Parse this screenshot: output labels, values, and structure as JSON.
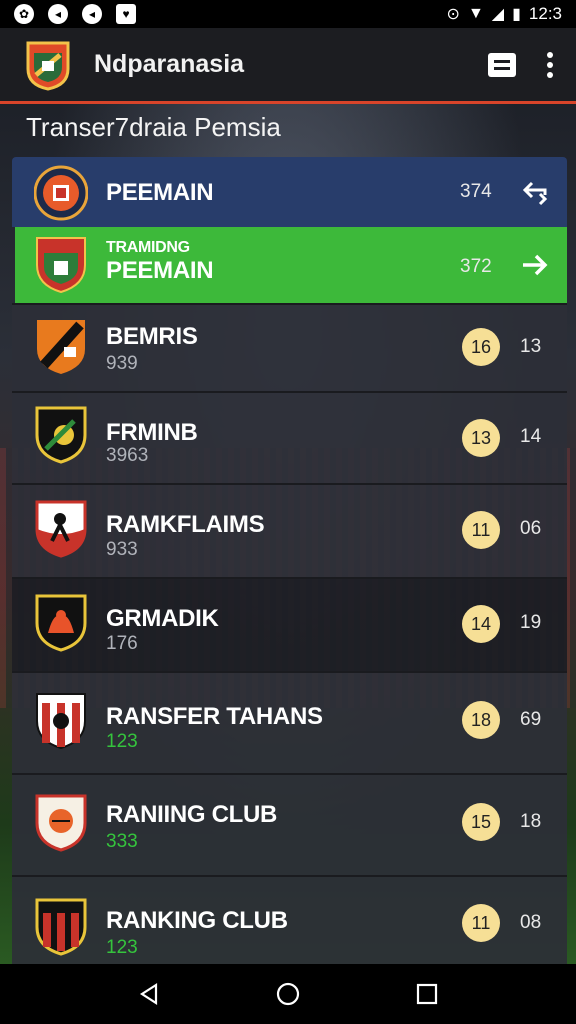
{
  "status_bar": {
    "left_icons": [
      "notification-icon-1",
      "notification-icon-2",
      "notification-icon-3",
      "notification-icon-4"
    ],
    "time": "12:3"
  },
  "app_bar": {
    "title": "Ndparanasia",
    "actions": [
      "list-icon",
      "more-vert-icon"
    ]
  },
  "section_title": "Transer7draia Pemsia",
  "rows": [
    {
      "name": "PEEMAIN",
      "score": "374",
      "icon": "swap-icon"
    },
    {
      "small_label": "TRAMIDNG",
      "name": "PEEMAIN",
      "score": "372",
      "icon": "arrow-right-icon"
    },
    {
      "name": "BEMRIS",
      "sub": "939",
      "badge": "16",
      "value": "13"
    },
    {
      "name": "FRMINB",
      "sub": "3963",
      "badge": "13",
      "value": "14"
    },
    {
      "name": "RAMKFLAIMS",
      "sub": "933",
      "badge": "11",
      "value": "06"
    },
    {
      "name": "GRMADIK",
      "sub": "176",
      "badge": "14",
      "value": "19"
    },
    {
      "name": "RANSFER TAHANS",
      "sub": "123",
      "badge": "18",
      "value": "69"
    },
    {
      "name": "RANIING CLUB",
      "sub": "333",
      "badge": "15",
      "value": "18"
    },
    {
      "name": "RANKING CLUB",
      "sub": "123",
      "badge": "11",
      "value": "08"
    }
  ],
  "colors": {
    "accent_red": "#d8442a",
    "highlight_blue": "#283d6b",
    "highlight_green": "#3db93a",
    "badge_yellow": "#f6df96"
  },
  "nav_bar": [
    "back-icon",
    "home-icon",
    "recents-icon"
  ]
}
